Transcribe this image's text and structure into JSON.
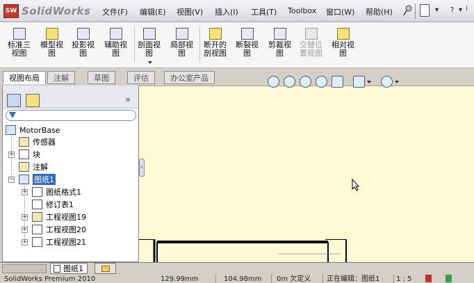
{
  "app": {
    "brand": "SolidWorks",
    "logo_text": "SW"
  },
  "menu": {
    "items": [
      "文件(F)",
      "编辑(E)",
      "视图(V)",
      "插入(I)",
      "工具(T)",
      "Toolbox",
      "窗口(W)",
      "帮助(H)"
    ],
    "help_label": "?"
  },
  "commands": [
    {
      "label": "标准三\n视图",
      "icon": "standard-3-views-icon"
    },
    {
      "label": "模型视\n图",
      "icon": "model-view-icon"
    },
    {
      "label": "投影视\n图",
      "icon": "projected-view-icon"
    },
    {
      "label": "辅助视\n图",
      "icon": "auxiliary-view-icon"
    },
    {
      "label": "剖面视\n图",
      "icon": "section-view-icon"
    },
    {
      "label": "局部视\n图",
      "icon": "detail-view-icon"
    },
    {
      "label": "断开的\n剖视图",
      "icon": "broken-out-section-icon"
    },
    {
      "label": "断裂视\n图",
      "icon": "break-view-icon"
    },
    {
      "label": "剪裁视\n图",
      "icon": "crop-view-icon"
    },
    {
      "label": "交替位\n置视图",
      "icon": "alternate-position-view-icon",
      "disabled": true
    },
    {
      "label": "相对视\n图",
      "icon": "relative-view-icon"
    }
  ],
  "tabs": [
    "视图布局",
    "注解",
    "草图",
    "评估",
    "办公室产品"
  ],
  "tree": {
    "root": "MotorBase",
    "nodes": [
      "传感器",
      "块",
      "注解",
      "图纸1",
      "图纸格式1",
      "修订表1",
      "工程视图19",
      "工程视图20",
      "工程视图21"
    ]
  },
  "sheet_tab": "图纸1",
  "status": {
    "product": "SolidWorks Premium 2010",
    "x": "129.99mm",
    "y": "104.98mm",
    "defined": "0m 欠定义",
    "editing": "正在编辑：图纸1",
    "scale": "1 : 5"
  },
  "colors": {
    "graphics_bg": "#fdfbd6",
    "selection": "#3169c6"
  }
}
